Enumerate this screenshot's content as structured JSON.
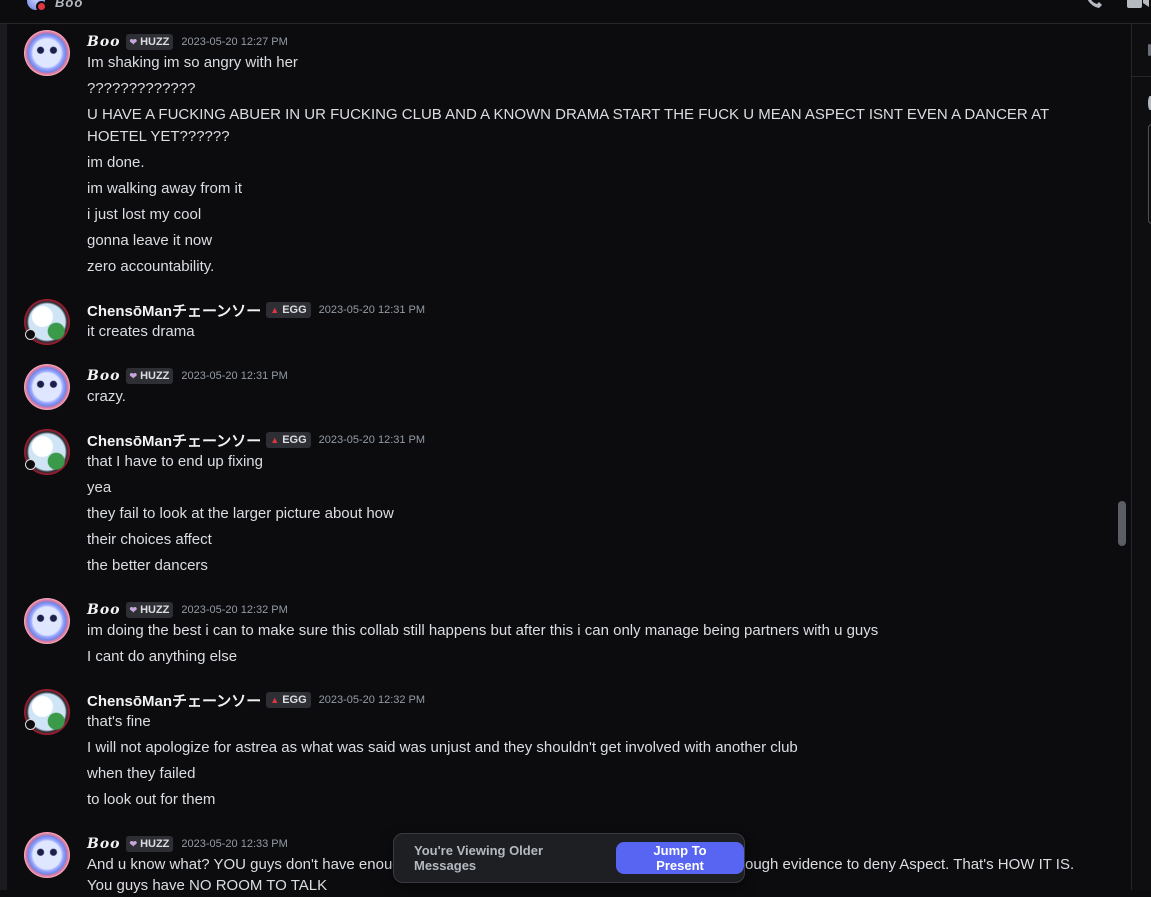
{
  "channel": {
    "title": "Boo"
  },
  "banner": {
    "text": "You're Viewing Older Messages",
    "button": "Jump To Present"
  },
  "groups": [
    {
      "user": "Boo",
      "tag": "HUZZ",
      "time": "2023-05-20 12:27 PM",
      "lines": [
        "Im shaking im so angry with her",
        "?????????????",
        "U HAVE A FUCKING ABUER IN UR FUCKING CLUB AND A KNOWN DRAMA START THE FUCK U MEAN ASPECT ISNT EVEN A DANCER AT HOETEL YET??????",
        "im done.",
        "im walking away from it",
        "i just lost my cool",
        "gonna leave it now",
        "zero accountability."
      ]
    },
    {
      "user": "ChensōManチェーンソー",
      "tag": "EGG",
      "time": "2023-05-20 12:31 PM",
      "lines": [
        "it creates drama"
      ]
    },
    {
      "user": "Boo",
      "tag": "HUZZ",
      "time": "2023-05-20 12:31 PM",
      "lines": [
        "crazy."
      ]
    },
    {
      "user": "ChensōManチェーンソー",
      "tag": "EGG",
      "time": "2023-05-20 12:31 PM",
      "lines": [
        "that I have to end up fixing",
        "yea",
        "they fail to look at the larger picture about how",
        "their choices affect",
        "the better dancers"
      ]
    },
    {
      "user": "Boo",
      "tag": "HUZZ",
      "time": "2023-05-20 12:32 PM",
      "lines": [
        "im doing the best i can to make sure this collab still happens but after this i can only manage being partners with u guys",
        "I cant do anything else"
      ]
    },
    {
      "user": "ChensōManチェーンソー",
      "tag": "EGG",
      "time": "2023-05-20 12:32 PM",
      "lines": [
        "that's fine",
        "I will not apologize for astrea as what was said was unjust and they shouldn't get involved with another club",
        "when they failed",
        "to look out for them"
      ]
    },
    {
      "user": "Boo",
      "tag": "HUZZ",
      "time": "2023-05-20 12:33 PM",
      "lines": [
        "And u know what? YOU guys don't have enoug",
        "ough evidence to deny Aspect. That's HOW IT IS.",
        "You guys have NO ROOM TO TALK"
      ]
    }
  ]
}
